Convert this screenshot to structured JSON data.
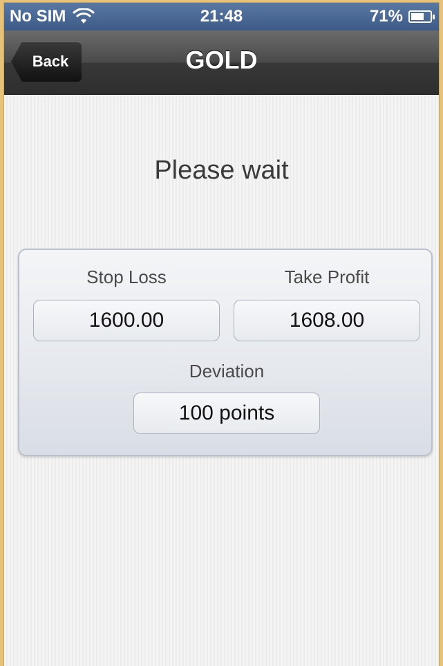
{
  "status_bar": {
    "carrier": "No SIM",
    "time": "21:48",
    "battery_percent": "71%",
    "battery_level": 0.71
  },
  "nav": {
    "back_label": "Back",
    "title": "GOLD"
  },
  "content": {
    "status_message": "Please wait",
    "stop_loss": {
      "label": "Stop Loss",
      "value": "1600.00"
    },
    "take_profit": {
      "label": "Take Profit",
      "value": "1608.00"
    },
    "deviation": {
      "label": "Deviation",
      "value": "100 points"
    }
  },
  "colors": {
    "status_bar": "#4a6a99",
    "nav_bar": "#3a3a3a",
    "background": "#f2f2f2",
    "frame_border": "#e8c27a"
  }
}
